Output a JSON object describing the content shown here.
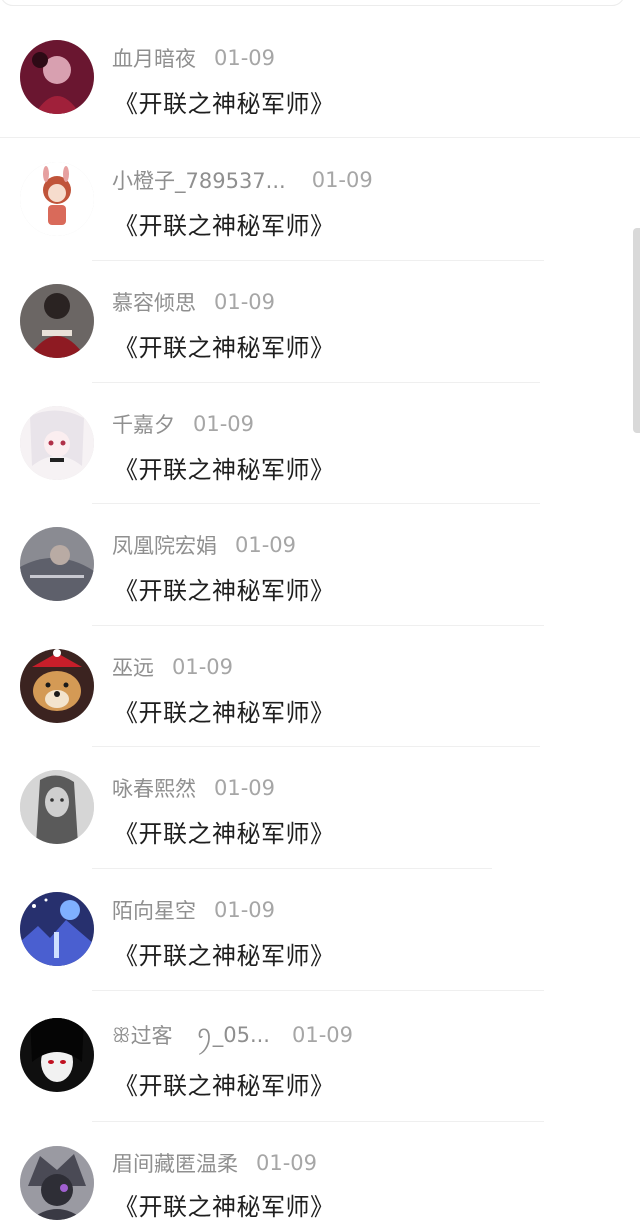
{
  "comments": [
    {
      "name": "血月暗夜",
      "date": "01-09",
      "text": "《开联之神秘军师》",
      "avatar_color": "#6a1630"
    },
    {
      "name": "小橙子_789537...",
      "date": "01-09",
      "text": "《开联之神秘军师》",
      "avatar_color": "#f4e6e0"
    },
    {
      "name": "慕容倾思",
      "date": "01-09",
      "text": "《开联之神秘军师》",
      "avatar_color": "#5a4a48"
    },
    {
      "name": "千嘉夕",
      "date": "01-09",
      "text": "《开联之神秘军师》",
      "avatar_color": "#f3eef0"
    },
    {
      "name": "凤凰院宏娟",
      "date": "01-09",
      "text": "《开联之神秘军师》",
      "avatar_color": "#7d7f86"
    },
    {
      "name": "巫远",
      "date": "01-09",
      "text": "《开联之神秘军师》",
      "avatar_color": "#b27a3a"
    },
    {
      "name": "咏春熙然",
      "date": "01-09",
      "text": "《开联之神秘军师》",
      "avatar_color": "#bdbdbd"
    },
    {
      "name": "陌向星空",
      "date": "01-09",
      "text": "《开联之神秘军师》",
      "avatar_color": "#3f4fa8"
    },
    {
      "name_glyph_left": "ꕥ",
      "name": "过客",
      "name_glyph_right": "ꪆ",
      "name_suffix": "_05...",
      "date": "01-09",
      "text": "《开联之神秘军师》",
      "avatar_color": "#1b1b1b"
    },
    {
      "name": "眉间藏匿温柔",
      "date": "01-09",
      "text": "《开联之神秘军师》",
      "avatar_color": "#8a8a92"
    }
  ]
}
